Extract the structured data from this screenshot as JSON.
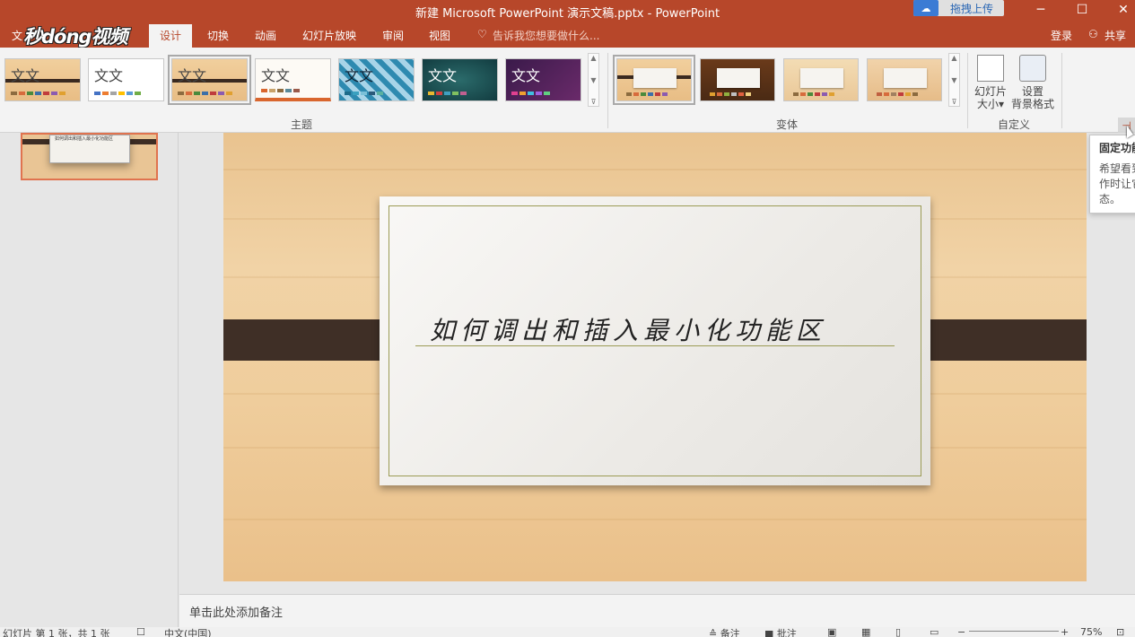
{
  "window": {
    "title": "新建 Microsoft PowerPoint 演示文稿.pptx - PowerPoint",
    "upload_label": "拖拽上传",
    "minimize": "─",
    "maximize": "☐",
    "close": "✕"
  },
  "watermark": "秒dóng视频",
  "tabs": {
    "file": "文",
    "design": "设计",
    "transitions": "切换",
    "animations": "动画",
    "slideshow": "幻灯片放映",
    "review": "审阅",
    "view": "视图",
    "tell_me": "告诉我您想要做什么...",
    "signin": "登录",
    "share": "共享"
  },
  "ribbon": {
    "theme_sample": "文文",
    "theme_group": "主题",
    "variant_group": "变体",
    "customize_group": "自定义",
    "slide_size": {
      "line1": "幻灯片",
      "line2": "大小▾"
    },
    "format_bg": {
      "line1": "设置",
      "line2": "背景格式"
    }
  },
  "thumbnail": {
    "title": "如何调出和插入最小化功能区"
  },
  "slide": {
    "title": "如何调出和插入最小化功能区"
  },
  "notes": {
    "placeholder": "单击此处添加备注"
  },
  "status": {
    "slide_info": "幻灯片 第 1 张，共 1 张",
    "language": "中文(中国)",
    "notes_btn": "≙ 备注",
    "comments_btn": "■ 批注",
    "zoom": "75%"
  },
  "tooltip": {
    "title": "固定功能区",
    "line1": "希望看到",
    "line2": "作时让它",
    "line3": "态。"
  },
  "colors": {
    "accent": "#b7472a",
    "wood": "#efcd9c",
    "band": "#3f2f26"
  }
}
